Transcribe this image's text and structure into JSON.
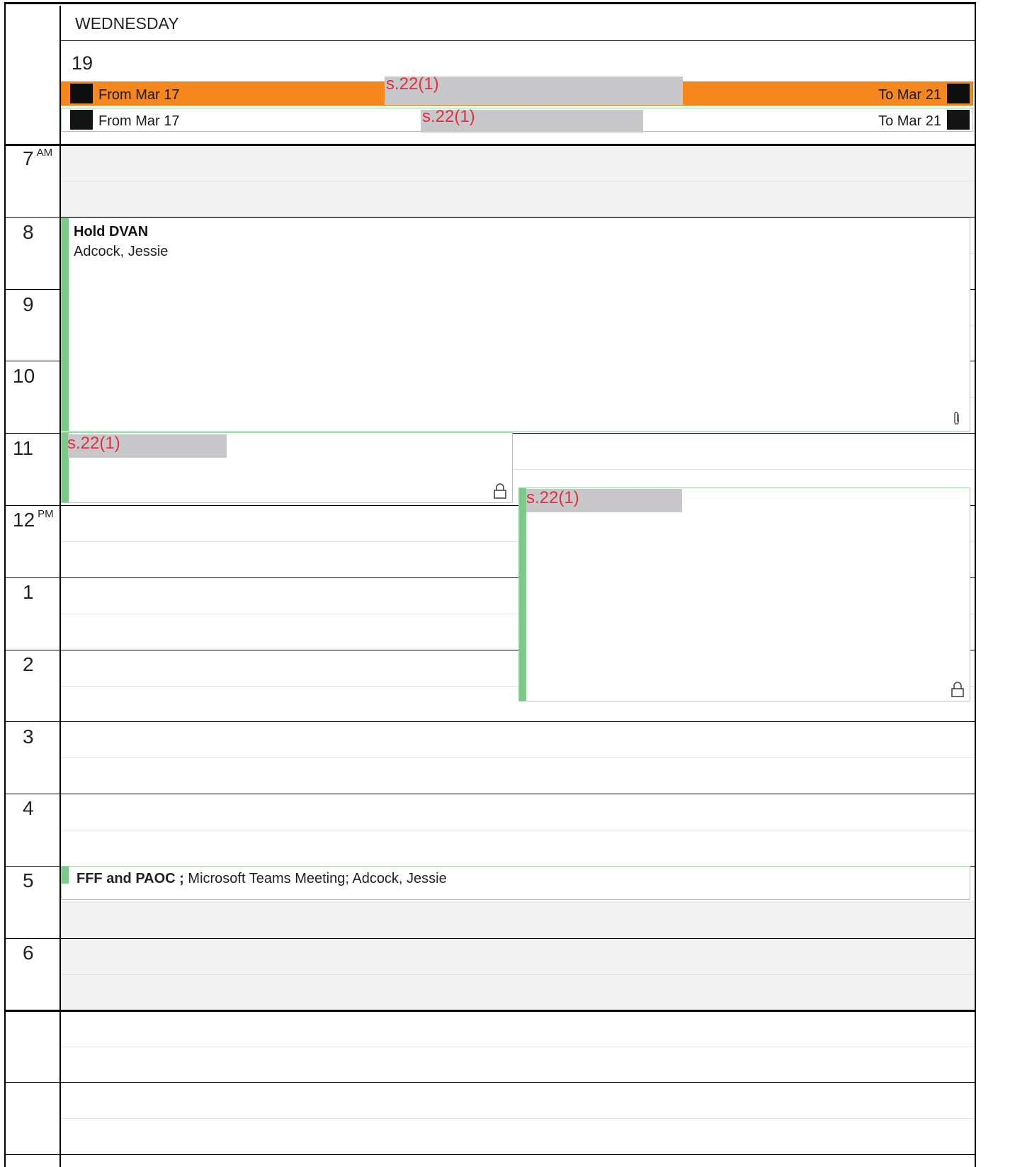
{
  "header": {
    "day_name": "WEDNESDAY",
    "day_number": "19"
  },
  "all_day_events": [
    {
      "from_label": "From Mar 17",
      "to_label": "To Mar 21",
      "redaction_label": "s.22(1)",
      "color": "#f5871f"
    },
    {
      "from_label": "From Mar 17",
      "to_label": "To Mar 21",
      "redaction_label": "s.22(1)",
      "color": "#ffffff"
    }
  ],
  "hours": [
    {
      "label": "7",
      "suffix": "AM"
    },
    {
      "label": "8",
      "suffix": ""
    },
    {
      "label": "9",
      "suffix": ""
    },
    {
      "label": "10",
      "suffix": ""
    },
    {
      "label": "11",
      "suffix": ""
    },
    {
      "label": "12",
      "suffix": "PM"
    },
    {
      "label": "1",
      "suffix": ""
    },
    {
      "label": "2",
      "suffix": ""
    },
    {
      "label": "3",
      "suffix": ""
    },
    {
      "label": "4",
      "suffix": ""
    },
    {
      "label": "5",
      "suffix": ""
    },
    {
      "label": "6",
      "suffix": ""
    }
  ],
  "events": {
    "hold_dvan": {
      "title": "Hold DVAN",
      "organizer": "Adcock, Jessie",
      "icon": "paperclip-icon"
    },
    "private_11am": {
      "redaction_label": "s.22(1)",
      "icon": "lock-icon"
    },
    "private_1130": {
      "redaction_label": "s.22(1)",
      "icon": "lock-icon"
    },
    "fff_paoc": {
      "title": "FFF and PAOC",
      "separator": " ; ",
      "details": "Microsoft Teams Meeting; Adcock, Jessie"
    }
  },
  "colors": {
    "accent_orange": "#f5871f",
    "event_green": "#7cc98a",
    "redaction_red": "#e03040"
  }
}
